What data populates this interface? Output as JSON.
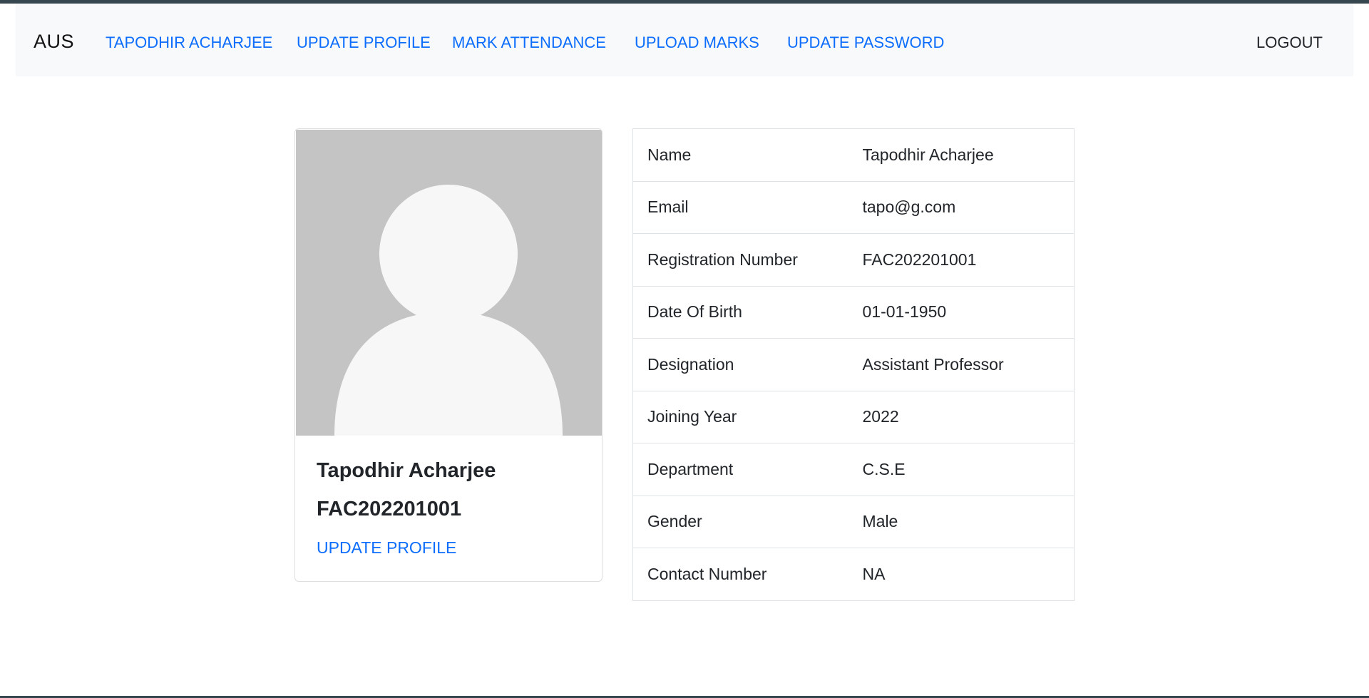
{
  "navbar": {
    "brand": "AUS",
    "links": [
      {
        "label": "TAPODHIR ACHARJEE"
      },
      {
        "label": "UPDATE PROFILE"
      },
      {
        "label": "MARK ATTENDANCE"
      },
      {
        "label": "UPLOAD MARKS"
      },
      {
        "label": "UPDATE PASSWORD"
      }
    ],
    "logout_label": "LOGOUT"
  },
  "profile_card": {
    "avatar_icon": "user-silhouette-icon",
    "name": "Tapodhir Acharjee",
    "registration": "FAC202201001",
    "update_link": "UPDATE PROFILE"
  },
  "details": {
    "rows": [
      {
        "label": "Name",
        "value": "Tapodhir Acharjee"
      },
      {
        "label": "Email",
        "value": "tapo@g.com"
      },
      {
        "label": "Registration Number",
        "value": "FAC202201001"
      },
      {
        "label": "Date Of Birth",
        "value": "01-01-1950"
      },
      {
        "label": "Designation",
        "value": "Assistant Professor"
      },
      {
        "label": "Joining Year",
        "value": "2022"
      },
      {
        "label": "Department",
        "value": "C.S.E"
      },
      {
        "label": "Gender",
        "value": "Male"
      },
      {
        "label": "Contact Number",
        "value": "NA"
      }
    ]
  },
  "colors": {
    "link": "#0d6efd",
    "navbar_bg": "#f8f9fa",
    "avatar_bg": "#c4c4c4",
    "top_strip": "#37474f"
  }
}
